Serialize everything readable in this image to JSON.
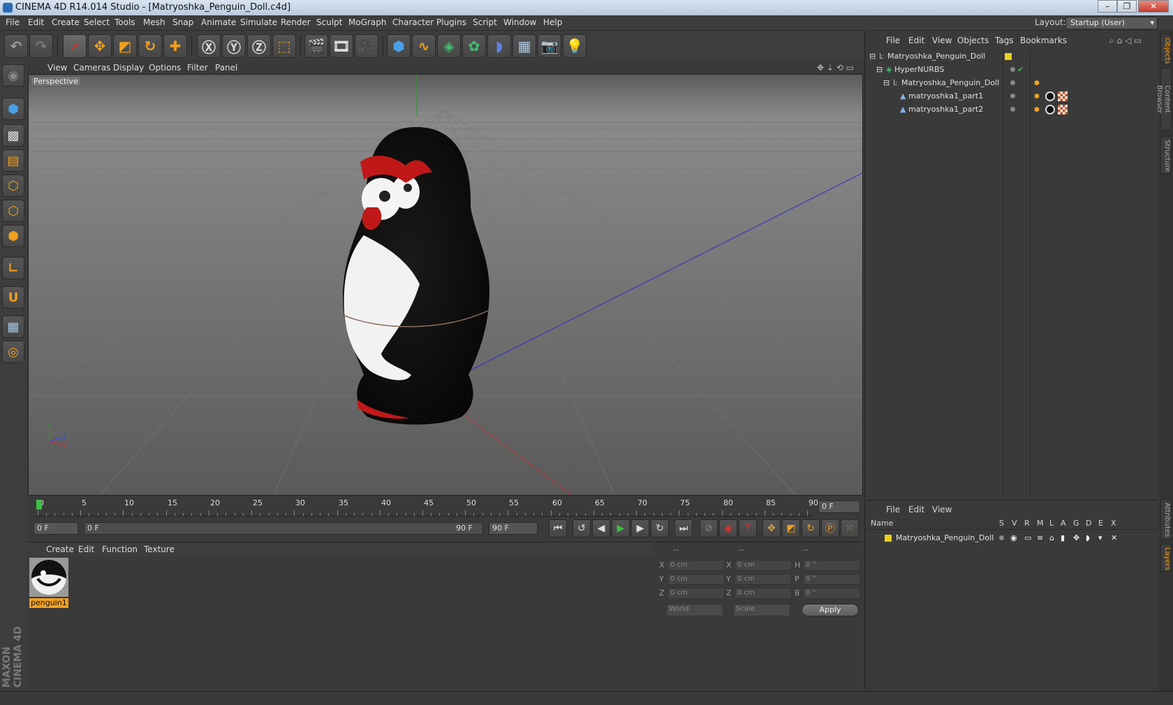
{
  "window": {
    "title": "CINEMA 4D R14.014 Studio - [Matryoshka_Penguin_Doll.c4d]",
    "btn_min": "–",
    "btn_max": "❐",
    "btn_close": "✕"
  },
  "menu": [
    "File",
    "Edit",
    "Create",
    "Select",
    "Tools",
    "Mesh",
    "Snap",
    "Animate",
    "Simulate",
    "Render",
    "Sculpt",
    "MoGraph",
    "Character",
    "Plugins",
    "Script",
    "Window",
    "Help"
  ],
  "layout": {
    "label": "Layout:",
    "value": "Startup (User)"
  },
  "viewport": {
    "menu": [
      "View",
      "Cameras",
      "Display",
      "Options",
      "Filter",
      "Panel"
    ],
    "label": "Perspective",
    "axis_x": "X",
    "axis_y": "Y",
    "axis_z": "Z"
  },
  "timeline": {
    "ticks": [
      "0",
      "5",
      "10",
      "15",
      "20",
      "25",
      "30",
      "35",
      "40",
      "45",
      "50",
      "55",
      "60",
      "65",
      "70",
      "75",
      "80",
      "85",
      "90"
    ],
    "current_frame": "0 F",
    "start_field": "0 F",
    "range_left": "0 F",
    "range_right": "90 F",
    "end_field": "90 F"
  },
  "materials": {
    "menu": [
      "Create",
      "Edit",
      "Function",
      "Texture"
    ],
    "items": [
      {
        "name": "penguin1"
      }
    ]
  },
  "coords": {
    "header": [
      "--",
      "--",
      "--"
    ],
    "rows": [
      {
        "a": "X",
        "av": "0 cm",
        "b": "X",
        "bv": "0 cm",
        "c": "H",
        "cv": "0 °"
      },
      {
        "a": "Y",
        "av": "0 cm",
        "b": "Y",
        "bv": "0 cm",
        "c": "P",
        "cv": "0 °"
      },
      {
        "a": "Z",
        "av": "0 cm",
        "b": "Z",
        "bv": "0 cm",
        "c": "B",
        "cv": "0 °"
      }
    ],
    "world": "World",
    "scale": "Scale",
    "apply": "Apply"
  },
  "objects": {
    "menu": [
      "File",
      "Edit",
      "View",
      "Objects",
      "Tags",
      "Bookmarks"
    ],
    "rows": [
      {
        "name": "Matryoshka_Penguin_Doll"
      },
      {
        "name": "HyperNURBS"
      },
      {
        "name": "Matryoshka_Penguin_Doll"
      },
      {
        "name": "matryoshka1_part1"
      },
      {
        "name": "matryoshka1_part2"
      }
    ]
  },
  "layers": {
    "menu": [
      "File",
      "Edit",
      "View"
    ],
    "columns": [
      "Name",
      "S",
      "V",
      "R",
      "M",
      "L",
      "A",
      "G",
      "D",
      "E",
      "X"
    ],
    "rows": [
      {
        "name": "Matryoshka_Penguin_Doll"
      }
    ]
  },
  "side_tabs": [
    "Objects",
    "Content Browser",
    "Structure",
    "Attributes",
    "Layers"
  ],
  "brand": "MAXON CINEMA 4D",
  "colors": {
    "accent": "#f0a020",
    "layer_yellow": "#e8d020"
  }
}
